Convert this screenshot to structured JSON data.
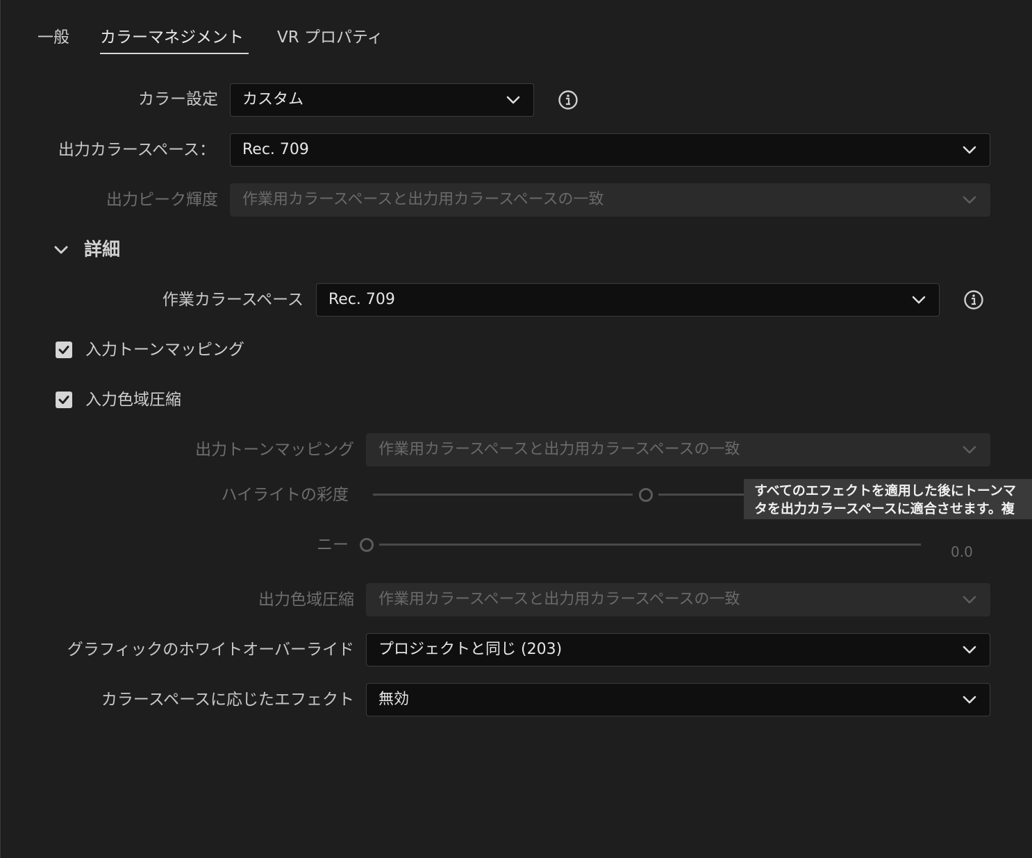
{
  "tabs": [
    {
      "label": "一般",
      "active": false
    },
    {
      "label": "カラーマネジメント",
      "active": true
    },
    {
      "label": "VR プロパティ",
      "active": false
    }
  ],
  "color_settings": {
    "label": "カラー設定",
    "value": "カスタム"
  },
  "output_color_space": {
    "label": "出力カラースペース：",
    "value": "Rec. 709"
  },
  "output_peak_luminance": {
    "label": "出力ピーク輝度",
    "value": "作業用カラースペースと出力用カラースペースの一致"
  },
  "details": {
    "title": "詳細",
    "working_color_space": {
      "label": "作業カラースペース",
      "value": "Rec. 709"
    },
    "input_tone_mapping": {
      "label": "入力トーンマッピング",
      "checked": true
    },
    "input_gamut_compression": {
      "label": "入力色域圧縮",
      "checked": true
    },
    "output_tone_mapping": {
      "label": "出力トーンマッピング",
      "value": "作業用カラースペースと出力用カラースペースの一致"
    },
    "highlight_saturation": {
      "label": "ハイライトの彩度"
    },
    "knee": {
      "label": "ニー",
      "value": "0.0"
    },
    "output_gamut_compression": {
      "label": "出力色域圧縮",
      "value": "作業用カラースペースと出力用カラースペースの一致"
    },
    "graphics_white_override": {
      "label": "グラフィックのホワイトオーバーライド",
      "value": "プロジェクトと同じ (203)"
    },
    "color_space_aware_effects": {
      "label": "カラースペースに応じたエフェクト",
      "value": "無効"
    }
  },
  "tooltip": {
    "line1": "すべてのエフェクトを適用した後にトーンマ",
    "line2": "タを出力カラースペースに適合させます。複"
  },
  "colors": {
    "background": "#1e1e1e",
    "dropdown": "#0f0f0f",
    "disabled": "#2b2b2b",
    "tooltip": "#3a3a3a"
  }
}
